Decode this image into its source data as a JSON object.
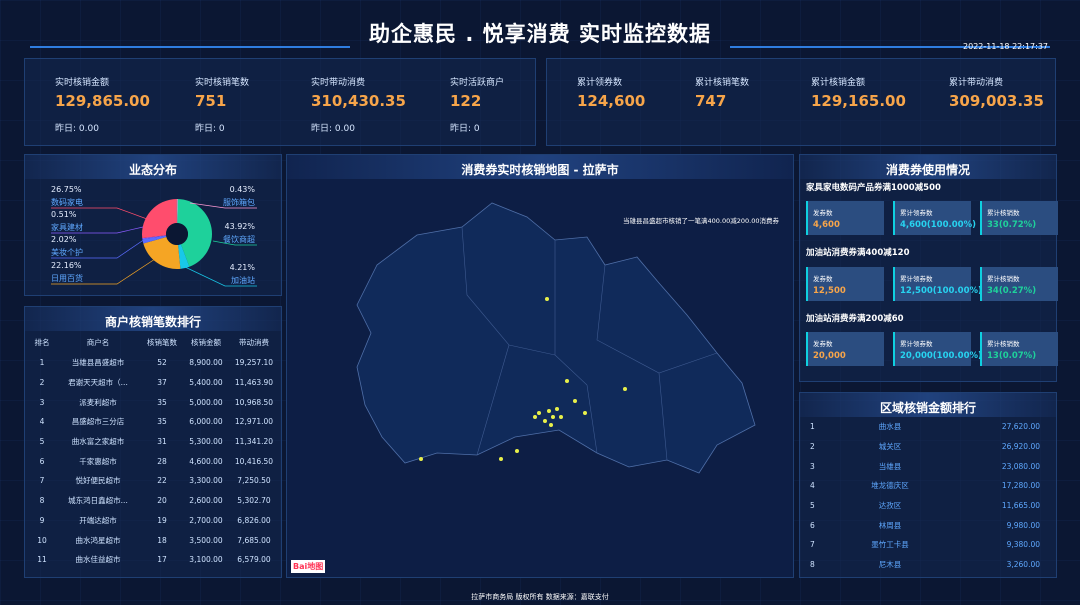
{
  "header": {
    "title": "助企惠民 . 悦享消费 实时监控数据",
    "datetime": "2022-11-18 22:17:37"
  },
  "stats_left": [
    {
      "label": "实时核销金额",
      "value": "129,865.00",
      "yesterday": "昨日: 0.00"
    },
    {
      "label": "实时核销笔数",
      "value": "751",
      "yesterday": "昨日: 0"
    },
    {
      "label": "实时带动消费",
      "value": "310,430.35",
      "yesterday": "昨日: 0.00"
    },
    {
      "label": "实时活跃商户",
      "value": "122",
      "yesterday": "昨日: 0"
    }
  ],
  "stats_right": [
    {
      "label": "累计领券数",
      "value": "124,600"
    },
    {
      "label": "累计核销笔数",
      "value": "747"
    },
    {
      "label": "累计核销金额",
      "value": "129,165.00"
    },
    {
      "label": "累计带动消费",
      "value": "309,003.35"
    }
  ],
  "business": {
    "title": "业态分布",
    "chart_data": {
      "type": "pie",
      "slices": [
        {
          "name": "数码家电",
          "pct": "26.75%",
          "value": 26.75,
          "color": "#ff4d6d"
        },
        {
          "name": "家具建材",
          "pct": "0.51%",
          "value": 0.51,
          "color": "#8a5cff"
        },
        {
          "name": "美妆个护",
          "pct": "2.02%",
          "value": 2.02,
          "color": "#5b6cff"
        },
        {
          "name": "日用百货",
          "pct": "22.16%",
          "value": 22.16,
          "color": "#f5a524"
        },
        {
          "name": "服饰箱包",
          "pct": "0.43%",
          "value": 0.43,
          "color": "#ff9ad5"
        },
        {
          "name": "餐饮商超",
          "pct": "43.92%",
          "value": 43.92,
          "color": "#1ed19b"
        },
        {
          "name": "加油站",
          "pct": "4.21%",
          "value": 4.21,
          "color": "#18c8e8"
        }
      ]
    }
  },
  "merchant_rank": {
    "title": "商户核销笔数排行",
    "columns": [
      "排名",
      "商户名",
      "核销笔数",
      "核销金额",
      "带动消费"
    ],
    "rows": [
      [
        "1",
        "当雄县昌盛超市",
        "52",
        "8,900.00",
        "19,257.10"
      ],
      [
        "2",
        "君谢天天超市（...",
        "37",
        "5,400.00",
        "11,463.90"
      ],
      [
        "3",
        "派麦利超市",
        "35",
        "5,000.00",
        "10,968.50"
      ],
      [
        "4",
        "昌盛超市三分店",
        "35",
        "6,000.00",
        "12,971.00"
      ],
      [
        "5",
        "曲水富之家超市",
        "31",
        "5,300.00",
        "11,341.20"
      ],
      [
        "6",
        "千家惠超市",
        "28",
        "4,600.00",
        "10,416.50"
      ],
      [
        "7",
        "悦好便民超市",
        "22",
        "3,300.00",
        "7,250.50"
      ],
      [
        "8",
        "城东鸿日鑫超市...",
        "20",
        "2,600.00",
        "5,302.70"
      ],
      [
        "9",
        "开端达超市",
        "19",
        "2,700.00",
        "6,826.00"
      ],
      [
        "10",
        "曲水鸿星超市",
        "18",
        "3,500.00",
        "7,685.00"
      ],
      [
        "11",
        "曲水佳益超市",
        "17",
        "3,100.00",
        "6,579.00"
      ]
    ]
  },
  "map": {
    "title": "消费券实时核销地图 - 拉萨市",
    "notice": "当雄县昌盛超市核销了一笔满400.00减200.00消费券",
    "logo_text": "Bai地图"
  },
  "coupon_usage": {
    "title": "消费券使用情况",
    "groups": [
      {
        "name": "家具家电数码产品券满1000减500",
        "items": [
          {
            "label": "发券数",
            "value": "4,600",
            "color": "#f7a54a"
          },
          {
            "label": "累计领券数",
            "value": "4,600(100.00%)",
            "color": "#27d3f0"
          },
          {
            "label": "累计核销数",
            "value": "33(0.72%)",
            "color": "#1ed19b"
          }
        ]
      },
      {
        "name": "加油站消费券满400减120",
        "items": [
          {
            "label": "发券数",
            "value": "12,500",
            "color": "#f7a54a"
          },
          {
            "label": "累计领券数",
            "value": "12,500(100.00%)",
            "color": "#27d3f0"
          },
          {
            "label": "累计核销数",
            "value": "34(0.27%)",
            "color": "#1ed19b"
          }
        ]
      },
      {
        "name": "加油站消费券满200减60",
        "items": [
          {
            "label": "发券数",
            "value": "20,000",
            "color": "#f7a54a"
          },
          {
            "label": "累计领券数",
            "value": "20,000(100.00%)",
            "color": "#27d3f0"
          },
          {
            "label": "累计核销数",
            "value": "13(0.07%)",
            "color": "#1ed19b"
          }
        ]
      }
    ]
  },
  "region_rank": {
    "title": "区域核销金额排行",
    "rows": [
      [
        "1",
        "曲水县",
        "27,620.00"
      ],
      [
        "2",
        "城关区",
        "26,920.00"
      ],
      [
        "3",
        "当雄县",
        "23,080.00"
      ],
      [
        "4",
        "堆龙德庆区",
        "17,280.00"
      ],
      [
        "5",
        "达孜区",
        "11,665.00"
      ],
      [
        "6",
        "林周县",
        "9,980.00"
      ],
      [
        "7",
        "墨竹工卡县",
        "9,380.00"
      ],
      [
        "8",
        "尼木县",
        "3,260.00"
      ]
    ]
  },
  "footer": {
    "text": "拉萨市商务局 版权所有 数据来源：嘉联支付"
  }
}
